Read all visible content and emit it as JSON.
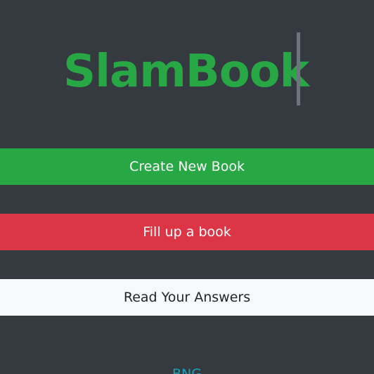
{
  "header": {
    "title": "SlamBook"
  },
  "actions": {
    "create_label": "Create New Book",
    "fill_label": "Fill up a book",
    "read_label": "Read Your Answers"
  },
  "footer": {
    "link_label": "BNG"
  },
  "colors": {
    "background": "#343a40",
    "title": "#28a745",
    "create": "#28a745",
    "fill": "#dc3545",
    "read": "#f8f9fa",
    "link": "#17a2b8"
  }
}
